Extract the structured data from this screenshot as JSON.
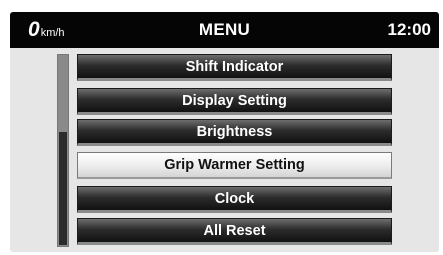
{
  "header": {
    "speed_value": "0",
    "speed_unit": "km/h",
    "title": "MENU",
    "time": "12:00"
  },
  "menu": {
    "items": [
      {
        "label": "Shift Indicator",
        "selected": false
      },
      {
        "label": "Display Setting",
        "selected": false
      },
      {
        "label": "Brightness",
        "selected": false
      },
      {
        "label": "Grip Warmer Setting",
        "selected": true
      },
      {
        "label": "Clock",
        "selected": false
      },
      {
        "label": "All Reset",
        "selected": false
      }
    ]
  },
  "colors": {
    "header_bg": "#050505",
    "screen_bg": "#e6e6e6",
    "item_dark": "#2c2c2c",
    "item_selected": "#ececec"
  }
}
